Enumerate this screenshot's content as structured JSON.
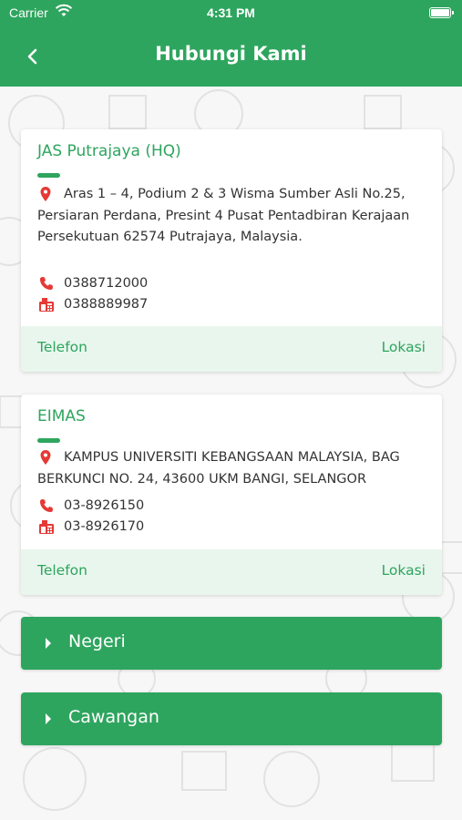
{
  "status_bar": {
    "carrier": "Carrier",
    "time": "4:31 PM"
  },
  "nav": {
    "title": "Hubungi Kami",
    "back_icon": "chevron-left-icon"
  },
  "offices": [
    {
      "name": "JAS Putrajaya (HQ)",
      "address": "Aras 1 – 4, Podium 2 & 3 Wisma Sumber Asli No.25, Persiaran Perdana, Presint 4 Pusat Pentadbiran Kerajaan Persekutuan 62574 Putrajaya, Malaysia.",
      "phone": "0388712000",
      "fax": "0388889987",
      "phone_button": "Telefon",
      "location_button": "Lokasi"
    },
    {
      "name": "EIMAS",
      "address": "KAMPUS UNIVERSITI KEBANGSAAN MALAYSIA, BAG BERKUNCI NO. 24, 43600 UKM BANGI, SELANGOR",
      "phone": "03-8926150",
      "fax": "03-8926170",
      "phone_button": "Telefon",
      "location_button": "Lokasi"
    }
  ],
  "sections": [
    {
      "label": "Negeri"
    },
    {
      "label": "Cawangan"
    }
  ],
  "colors": {
    "primary": "#2ea55e",
    "icon_red": "#e53935",
    "footer_bg": "#e9f6ee"
  }
}
